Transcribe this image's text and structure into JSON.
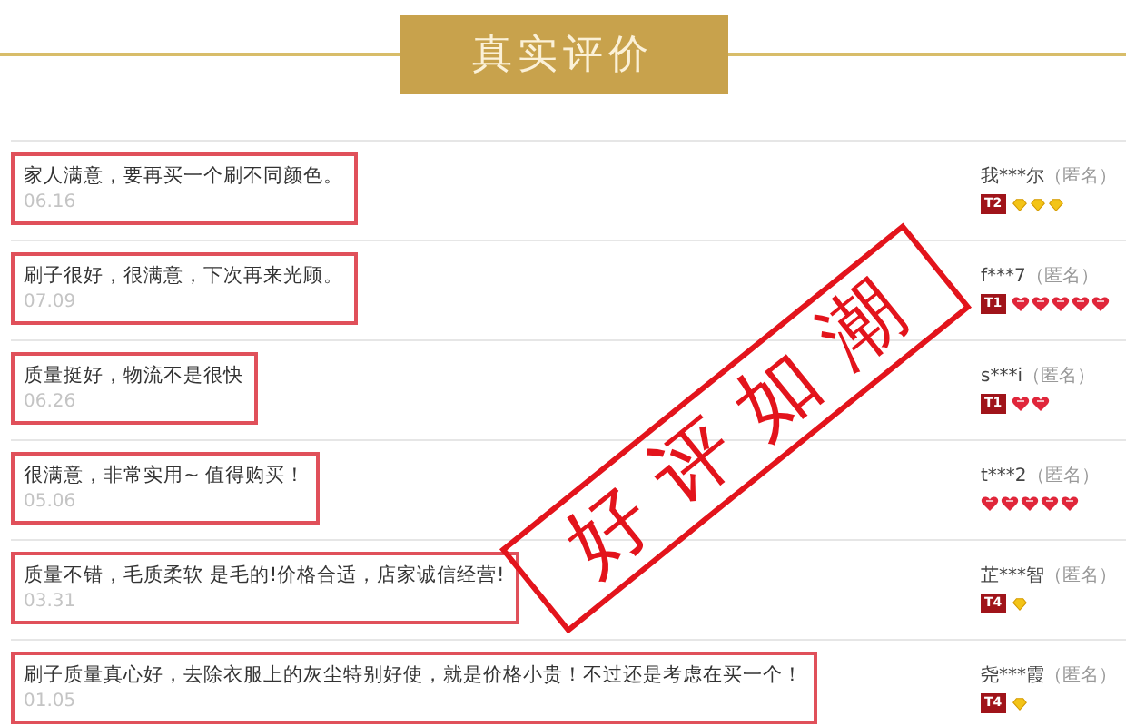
{
  "header": {
    "title": "真实评价"
  },
  "reviews": [
    {
      "comment": "家人满意，要再买一个刷不同颜色。",
      "date": "06.16",
      "highlighted": true,
      "user": "我***尔",
      "anonymous_label": "（匿名）",
      "badge": "T2",
      "gems": [
        {
          "kind": "diamond"
        },
        {
          "kind": "diamond"
        },
        {
          "kind": "diamond"
        }
      ]
    },
    {
      "comment": "刷子很好，很满意，下次再来光顾。",
      "date": "07.09",
      "highlighted": true,
      "user": "f***7",
      "anonymous_label": "（匿名）",
      "badge": "T1",
      "gems": [
        {
          "kind": "heart"
        },
        {
          "kind": "heart"
        },
        {
          "kind": "heart"
        },
        {
          "kind": "heart"
        },
        {
          "kind": "heart"
        }
      ]
    },
    {
      "comment": "质量挺好，物流不是很快",
      "date": "06.26",
      "highlighted": true,
      "user": "s***i",
      "anonymous_label": "（匿名）",
      "badge": "T1",
      "gems": [
        {
          "kind": "heart"
        },
        {
          "kind": "heart"
        }
      ]
    },
    {
      "comment": "很满意，非常实用~ 值得购买！",
      "date": "05.06",
      "highlighted": true,
      "user": "t***2",
      "anonymous_label": "（匿名）",
      "gems": [
        {
          "kind": "heart"
        },
        {
          "kind": "heart"
        },
        {
          "kind": "heart"
        },
        {
          "kind": "heart"
        },
        {
          "kind": "heart"
        }
      ]
    },
    {
      "comment": "质量不错，毛质柔软 是毛的!价格合适，店家诚信经营!",
      "date": "03.31",
      "highlighted": true,
      "user": "芷***智",
      "anonymous_label": "（匿名）",
      "badge": "T4",
      "gems": [
        {
          "kind": "diamond"
        }
      ]
    },
    {
      "comment": "刷子质量真心好，去除衣服上的灰尘特别好使，就是价格小贵！不过还是考虑在买一个！",
      "date": "01.05",
      "highlighted": true,
      "user": "尧***霞",
      "anonymous_label": "（匿名）",
      "badge": "T4",
      "gems": [
        {
          "kind": "diamond"
        }
      ]
    }
  ],
  "stamp": {
    "text": "好评如潮"
  }
}
